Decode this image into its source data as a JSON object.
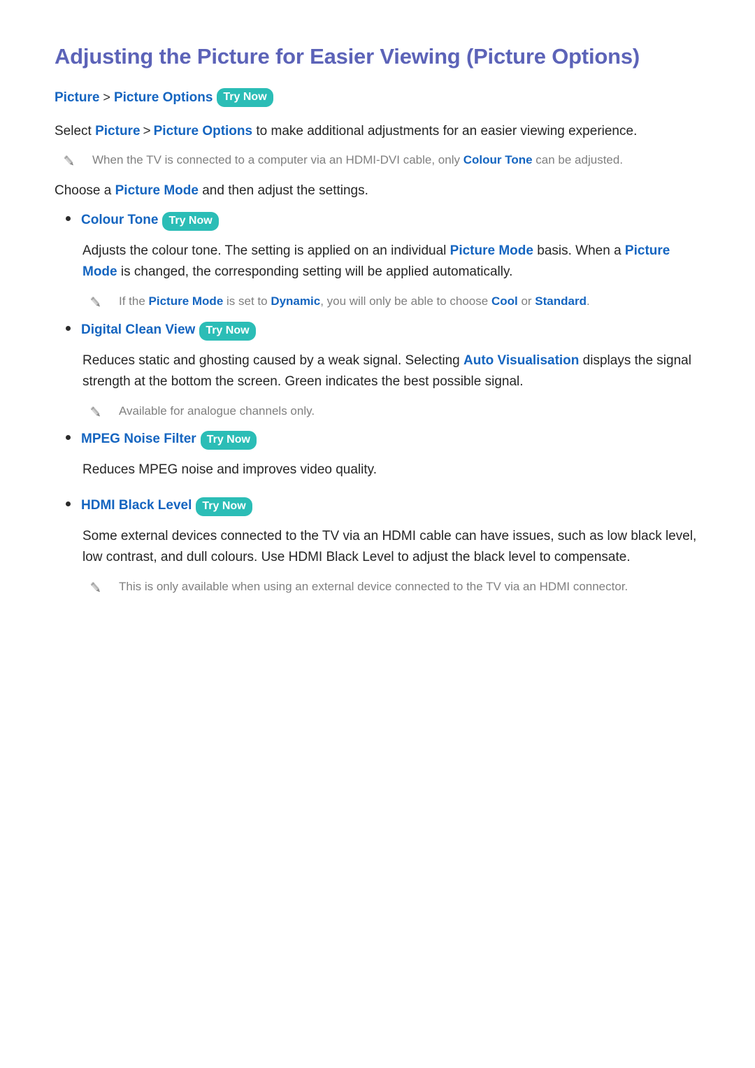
{
  "page": {
    "title": "Adjusting the Picture for Easier Viewing (Picture Options)",
    "title_color": "#5c63b8",
    "link_color": "#1565c0",
    "badge_color": "#2bbdb6",
    "note_color": "#808080",
    "body_color": "#262626",
    "background": "#ffffff"
  },
  "breadcrumb": {
    "name": "breadcrumb",
    "items": [
      "Picture",
      "Picture Options"
    ],
    "separator": ">",
    "badge": "Try Now"
  },
  "intro": {
    "prefix": "Select ",
    "term1": "Picture",
    "separator": ">",
    "term2": "Picture Options",
    "suffix": " to make additional adjustments for an easier viewing experience."
  },
  "note_hdmi_dvi": {
    "icon": "pencil-icon",
    "part1": "When the TV is connected to a computer via an HDMI-DVI cable, only ",
    "keyword": "Colour Tone",
    "part2": " can be adjusted."
  },
  "choose_line": {
    "prefix": "Choose a ",
    "keyword": "Picture Mode",
    "suffix": " and then adjust the settings."
  },
  "options": [
    {
      "label": "Colour Tone",
      "badge": "Try Now",
      "body": {
        "part1": "Adjusts the colour tone. The setting is applied on an individual ",
        "kw1": "Picture Mode",
        "part2": " basis. When a ",
        "kw2": "Picture Mode",
        "part3": " is changed, the corresponding setting will be applied automatically."
      },
      "note": {
        "icon": "pencil-icon",
        "part1": "If the ",
        "kw1": "Picture Mode",
        "part2": " is set to ",
        "kw2": "Dynamic",
        "part3": ", you will only be able to choose ",
        "kw3": "Cool",
        "part4": " or ",
        "kw4": "Standard",
        "part5": "."
      }
    },
    {
      "label": "Digital Clean View",
      "badge": "Try Now",
      "body": {
        "part1": "Reduces static and ghosting caused by a weak signal. Selecting ",
        "kw1": "Auto Visualisation",
        "part2": " displays the signal strength at the bottom the screen. Green indicates the best possible signal."
      },
      "note": {
        "icon": "pencil-icon",
        "text": "Available for analogue channels only."
      }
    },
    {
      "label": "MPEG Noise Filter",
      "badge": "Try Now",
      "body": {
        "plain": "Reduces MPEG noise and improves video quality."
      }
    },
    {
      "label": "HDMI Black Level",
      "badge": "Try Now",
      "body": {
        "plain": "Some external devices connected to the TV via an HDMI cable can have issues, such as low black level, low contrast, and dull colours. Use HDMI Black Level to adjust the black level to compensate."
      },
      "note": {
        "icon": "pencil-icon",
        "text": "This is only available when using an external device connected to the TV via an HDMI connector."
      }
    }
  ]
}
